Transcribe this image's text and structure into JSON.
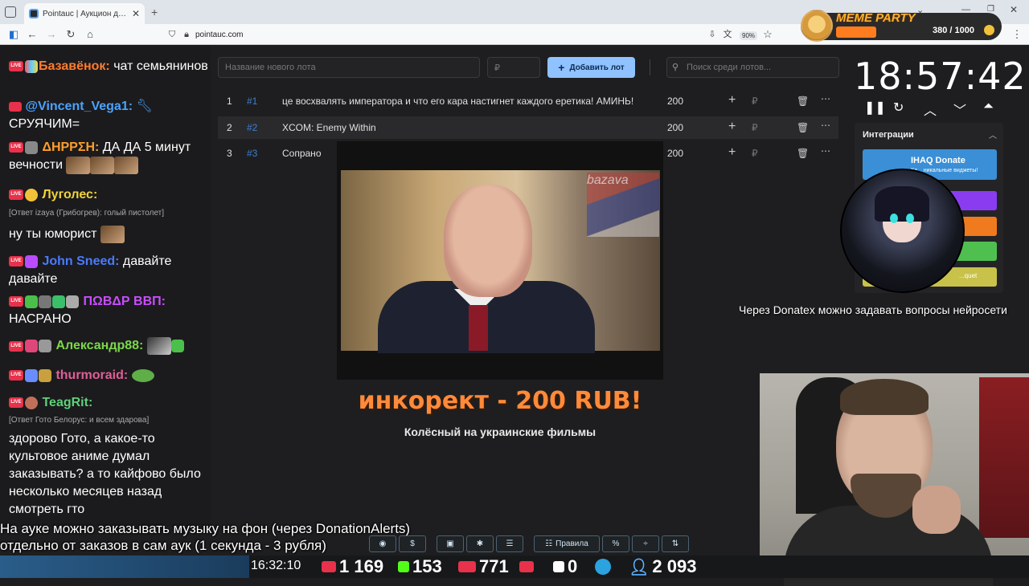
{
  "browser": {
    "tab_title": "Pointauc | Аукцион для стрим...",
    "url": "pointauc.com",
    "zoom": "90%"
  },
  "meme_party": {
    "title": "MEME PARTY",
    "count": "380 / 1000"
  },
  "chat": [
    {
      "nick": "Базавёнок:",
      "text": "чат семьянинов",
      "color": "#ff7b2e"
    },
    {
      "nick": "@Vincent_Vega1:",
      "text": "СРУЯЧИМ=",
      "color": "#4aa3ff"
    },
    {
      "nick": "ΔΗΡΡΣΗ:",
      "text": "ДА ДА 5 минут вечности",
      "color": "#ff9e2e"
    },
    {
      "nick": "Луголес:",
      "text": "ну ты юморист",
      "color": "#f0d23c",
      "reply": "[Ответ izaya (Грибогрев): голый пистолет]"
    },
    {
      "nick": "John Sneed:",
      "text": "давайте давайте",
      "color": "#4a7bff"
    },
    {
      "nick": "ΠΩΒΔΡ ΒΒΠ:",
      "text": "НАСРАНО",
      "color": "#c94cff"
    },
    {
      "nick": "Александр88:",
      "text": "",
      "color": "#7bd84a"
    },
    {
      "nick": "thurmoraid:",
      "text": "",
      "color": "#e05e9a"
    },
    {
      "nick": "TeagRit:",
      "text": "здорово Гото, а какое-то культовое аниме думал заказывать? а то кайфово было несколько месяцев назад смотреть гто",
      "color": "#5fd07a",
      "reply": "[Ответ Гото Белорус: и всем здарова]"
    }
  ],
  "toolbar": {
    "new_lot_placeholder": "Название нового лота",
    "price_placeholder": "₽",
    "add_label": "Добавить лот",
    "search_placeholder": "Поиск среди лотов..."
  },
  "lots": [
    {
      "num": "1",
      "tag": "#1",
      "name": "це восхвалять императора и что его кара настигнет каждого еретика! АМИНЬ!",
      "amount": "200"
    },
    {
      "num": "2",
      "tag": "#2",
      "name": "XCOM: Enemy Within",
      "amount": "200"
    },
    {
      "num": "3",
      "tag": "#3",
      "name": "Сопрано",
      "amount": "200"
    }
  ],
  "donation": {
    "watermark": "bazava",
    "title": "инкорект - 200 RUB!",
    "message": "Колёсный на украинские фильмы"
  },
  "timer": "18:57:42",
  "integrations": {
    "title": "Интеграции",
    "donate_title": "IHAQ Donate",
    "donate_sub": "Ка... никальные виджеты!",
    "other_label": "...quet"
  },
  "info_text": "Через Donatex можно задавать вопросы нейросети",
  "subtitles": [
    "На ауке можно заказывать музыку на фон (через DonationAlerts)",
    "отдельно от заказов в сам аук (1 секунда - 3 рубля)"
  ],
  "tools": {
    "rules_label": "Правила",
    "percent": "%"
  },
  "status": {
    "clock": "16:32:10",
    "youtube": "1 169",
    "kick": "153",
    "vk": "771",
    "rutube": "0",
    "viewers": "2 093"
  }
}
